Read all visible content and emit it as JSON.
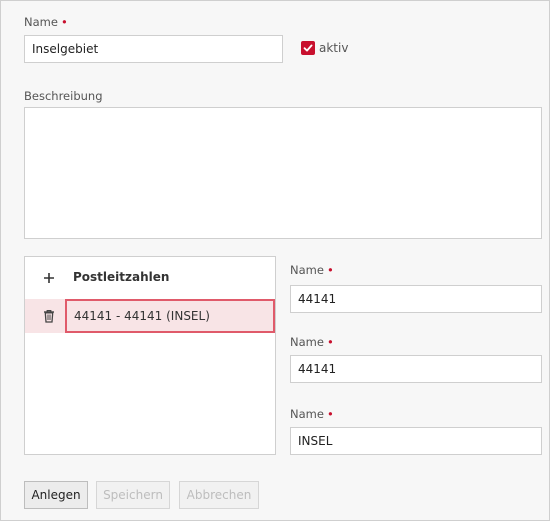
{
  "form": {
    "name_label": "Name",
    "required_marker": "•",
    "name_value": "Inselgebiet",
    "active_label": "aktiv",
    "active_checked": true,
    "description_label": "Beschreibung",
    "description_value": ""
  },
  "postcodes": {
    "add_icon": "+",
    "header": "Postleitzahlen",
    "items": [
      {
        "label": "44141 - 44141 (INSEL)"
      }
    ]
  },
  "detail": {
    "fields": [
      {
        "label": "Name",
        "value": "44141"
      },
      {
        "label": "Name",
        "value": "44141"
      },
      {
        "label": "Name",
        "value": "INSEL"
      }
    ]
  },
  "buttons": {
    "create": "Anlegen",
    "save": "Speichern",
    "cancel": "Abbrechen"
  },
  "colors": {
    "accent": "#c8102e",
    "selected_row_bg": "#f8e4e6",
    "selected_row_border": "#e05a6a"
  }
}
